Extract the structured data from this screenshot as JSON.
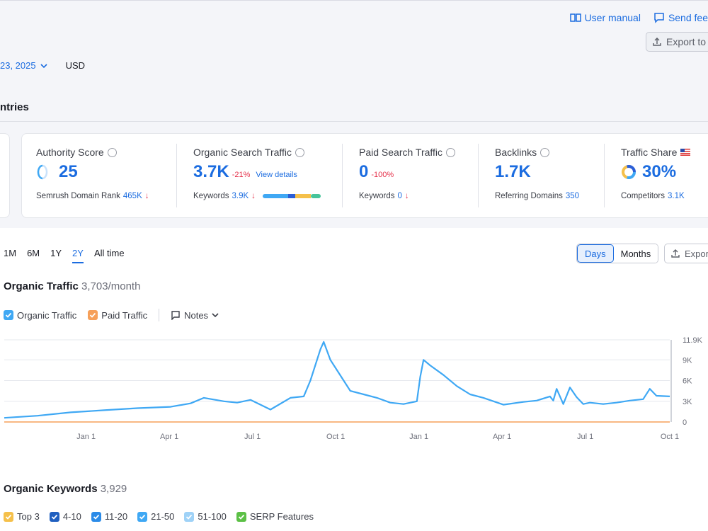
{
  "header": {
    "user_manual": "User manual",
    "send_feedback": "Send fee",
    "export_button": "Export to",
    "date": "23, 2025",
    "currency": "USD",
    "countries_label": "ntries"
  },
  "metrics": [
    {
      "label": "Authority Score",
      "value": "25",
      "sub_label": "Semrush Domain Rank",
      "sub_value": "465K"
    },
    {
      "label": "Organic Search Traffic",
      "value": "3.7K",
      "delta": "-21%",
      "link": "View details",
      "sub_label": "Keywords",
      "sub_value": "3.9K"
    },
    {
      "label": "Paid Search Traffic",
      "value": "0",
      "delta": "-100%",
      "sub_label": "Keywords",
      "sub_value": "0"
    },
    {
      "label": "Backlinks",
      "value": "1.7K",
      "sub_label": "Referring Domains",
      "sub_value": "350"
    },
    {
      "label": "Traffic Share",
      "value": "30%",
      "sub_label": "Competitors",
      "sub_value": "3.1K"
    }
  ],
  "range_tabs": [
    "1M",
    "6M",
    "1Y",
    "2Y",
    "All time"
  ],
  "active_range": "2Y",
  "view_toggle": {
    "days": "Days",
    "months": "Months"
  },
  "export_label": "Export",
  "organic_traffic": {
    "title": "Organic Traffic",
    "value": "3,703/month",
    "legend": {
      "organic": "Organic Traffic",
      "paid": "Paid Traffic",
      "notes": "Notes"
    }
  },
  "organic_keywords": {
    "title": "Organic Keywords",
    "value": "3,929",
    "legend": [
      "Top 3",
      "4-10",
      "11-20",
      "21-50",
      "51-100",
      "SERP Features"
    ]
  },
  "colors": {
    "accent": "#1b6ce0",
    "organic": "#3fa8f4",
    "paid": "#f6a05a",
    "top3": "#f5c04a",
    "pos4_10": "#1f5fc0",
    "pos11_20": "#2b8be8",
    "pos21_50": "#3fa8f4",
    "pos51_100": "#9fd2f7",
    "serp": "#5cc046"
  },
  "chart_data": {
    "type": "line",
    "x_tick_labels": [
      "Jan 1",
      "Apr 1",
      "Jul 1",
      "Oct 1",
      "Jan 1",
      "Apr 1",
      "Jul 1",
      "Oct 1"
    ],
    "y_tick_labels": [
      "11.9K",
      "9K",
      "6K",
      "3K",
      "0"
    ],
    "ylim": [
      0,
      11900
    ],
    "grid": true,
    "series": [
      {
        "name": "Organic Traffic",
        "x": [
          0,
          0.05,
          0.1,
          0.15,
          0.2,
          0.25,
          0.28,
          0.3,
          0.33,
          0.35,
          0.37,
          0.4,
          0.43,
          0.45,
          0.46,
          0.475,
          0.48,
          0.49,
          0.5,
          0.51,
          0.52,
          0.54,
          0.56,
          0.58,
          0.6,
          0.62,
          0.625,
          0.63,
          0.64,
          0.66,
          0.68,
          0.7,
          0.72,
          0.75,
          0.78,
          0.8,
          0.82,
          0.825,
          0.83,
          0.84,
          0.85,
          0.86,
          0.87,
          0.88,
          0.9,
          0.92,
          0.94,
          0.96,
          0.97,
          0.98,
          1.0
        ],
        "values": [
          600,
          900,
          1400,
          1700,
          2000,
          2200,
          2700,
          3500,
          3000,
          2800,
          3200,
          1800,
          3500,
          3700,
          6000,
          10500,
          11600,
          9000,
          7500,
          6000,
          4500,
          4000,
          3500,
          2800,
          2600,
          3000,
          6500,
          9000,
          8200,
          6800,
          5200,
          4000,
          3500,
          2500,
          2900,
          3100,
          3700,
          3100,
          4800,
          2600,
          5000,
          3600,
          2600,
          2800,
          2600,
          2800,
          3100,
          3300,
          4800,
          3800,
          3700
        ]
      },
      {
        "name": "Paid Traffic",
        "x": [
          0,
          1.0
        ],
        "values": [
          0,
          0
        ]
      }
    ]
  }
}
